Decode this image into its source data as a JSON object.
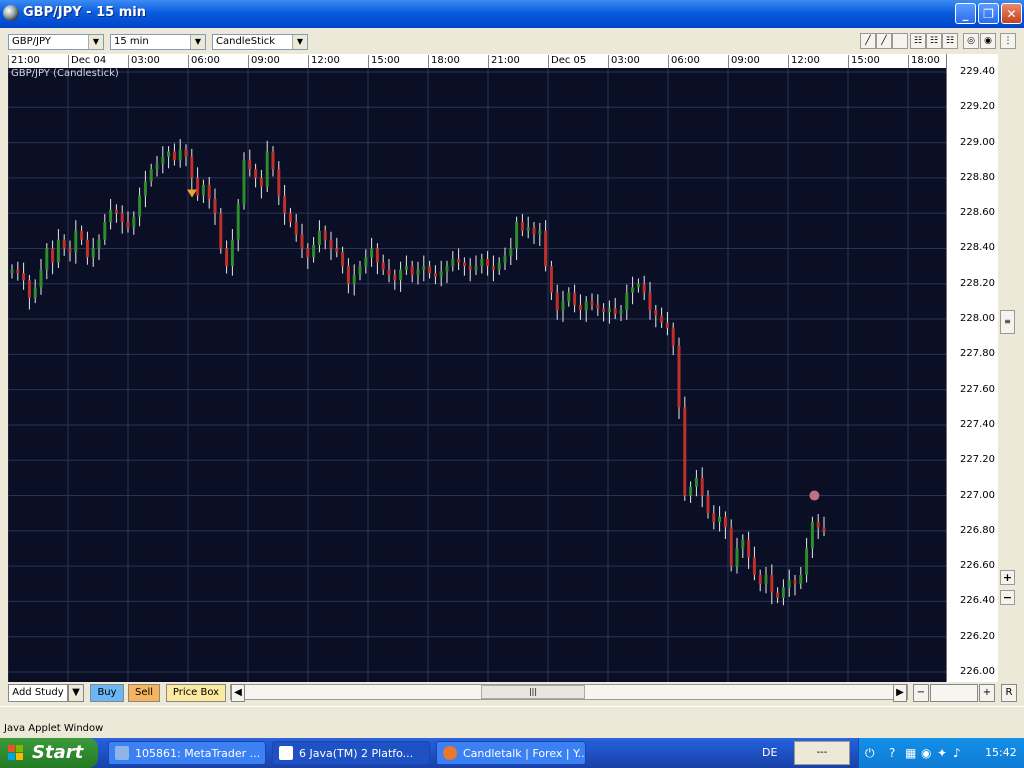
{
  "window": {
    "title": "GBP/JPY - 15 min",
    "min": "_",
    "max": "❐",
    "close": "✕"
  },
  "toolbar": {
    "symbol": "GBP/JPY",
    "interval": "15 min",
    "chart_type": "CandleStick"
  },
  "chart": {
    "label": "GBP/JPY (Candlestick)",
    "time_labels": [
      "21:00",
      "Dec 04",
      "03:00",
      "06:00",
      "09:00",
      "12:00",
      "15:00",
      "18:00",
      "21:00",
      "Dec 05",
      "03:00",
      "06:00",
      "09:00",
      "12:00",
      "15:00",
      "18:00"
    ],
    "price_labels": [
      "229.40",
      "229.20",
      "229.00",
      "228.80",
      "228.60",
      "228.40",
      "228.20",
      "228.00",
      "227.80",
      "227.60",
      "227.40",
      "227.20",
      "227.00",
      "226.80",
      "226.60",
      "226.40",
      "226.20",
      "226.00"
    ],
    "up_color": "#2e8b2e",
    "down_color": "#c0302a",
    "grid_color": "#2a3555",
    "marker_color": "#f0a030",
    "dot_color": "#c07080"
  },
  "chart_data": {
    "type": "candlestick",
    "title": "GBP/JPY (Candlestick)",
    "ylim": [
      226.0,
      229.4
    ],
    "x_labels": [
      "21:00",
      "Dec 04",
      "03:00",
      "06:00",
      "09:00",
      "12:00",
      "15:00",
      "18:00",
      "21:00",
      "Dec 05",
      "03:00",
      "06:00",
      "09:00",
      "12:00",
      "15:00",
      "18:00"
    ],
    "closes": [
      228.28,
      228.26,
      228.22,
      228.12,
      228.18,
      228.28,
      228.4,
      228.32,
      228.45,
      228.4,
      228.38,
      228.5,
      228.45,
      228.35,
      228.4,
      228.45,
      228.55,
      228.62,
      228.6,
      228.55,
      228.52,
      228.58,
      228.7,
      228.78,
      228.85,
      228.88,
      228.92,
      228.95,
      228.9,
      228.96,
      228.92,
      228.8,
      228.7,
      228.76,
      228.68,
      228.6,
      228.4,
      228.3,
      228.45,
      228.65,
      228.9,
      228.85,
      228.8,
      228.75,
      228.95,
      228.85,
      228.7,
      228.6,
      228.55,
      228.48,
      228.4,
      228.35,
      228.42,
      228.5,
      228.45,
      228.4,
      228.38,
      228.3,
      228.2,
      228.25,
      228.3,
      228.35,
      228.4,
      228.32,
      228.28,
      228.25,
      228.22,
      228.28,
      228.3,
      228.25,
      228.28,
      228.3,
      228.26,
      228.24,
      228.27,
      228.3,
      228.34,
      228.32,
      228.3,
      228.28,
      228.3,
      228.34,
      228.3,
      228.28,
      228.32,
      228.36,
      228.4,
      228.55,
      228.5,
      228.52,
      228.48,
      228.5,
      228.3,
      228.15,
      228.05,
      228.1,
      228.15,
      228.08,
      228.05,
      228.1,
      228.08,
      228.06,
      228.04,
      228.06,
      228.03,
      228.05,
      228.15,
      228.18,
      228.2,
      228.15,
      228.05,
      228.02,
      227.98,
      227.95,
      227.85,
      227.5,
      227.0,
      227.05,
      227.1,
      227.0,
      226.9,
      226.85,
      226.88,
      226.82,
      226.6,
      226.7,
      226.75,
      226.65,
      226.55,
      226.5,
      226.55,
      226.45,
      226.42,
      226.48,
      226.52,
      226.5,
      226.55,
      226.7,
      226.85,
      226.82,
      226.8
    ]
  },
  "axis_controls": {
    "plus": "+",
    "minus": "−",
    "reset": "R"
  },
  "bottom": {
    "add_study": "Add Study",
    "buy": "Buy",
    "sell": "Sell",
    "price_box": "Price Box",
    "scroll_left": "◀",
    "scroll_right": "▶",
    "zoom_out": "−",
    "zoom_in": "+",
    "reset": "R"
  },
  "status": {
    "text": "Java Applet Window"
  },
  "taskbar": {
    "start": "Start",
    "tasks": [
      "105861: MetaTrader ...",
      "6 Java(TM) 2 Platfo...",
      "Candletalk | Forex | Y..."
    ],
    "language": "DE",
    "lang_box": "---",
    "clock": "15:42"
  }
}
